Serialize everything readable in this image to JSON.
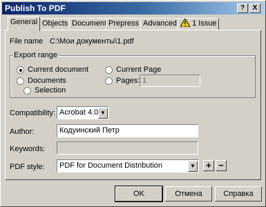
{
  "window": {
    "title": "Publish To PDF",
    "help_btn": "?",
    "close_btn": "X"
  },
  "tabs": [
    {
      "label": "General"
    },
    {
      "label": "Objects"
    },
    {
      "label": "Document"
    },
    {
      "label": "Prepress"
    },
    {
      "label": "Advanced"
    },
    {
      "label": "1 Issue",
      "icon": "warning-icon"
    }
  ],
  "general": {
    "file_name_label": "File name",
    "file_name_value": "C:\\Мои документы\\1.pdf",
    "export_range": {
      "legend": "Export range",
      "options": [
        {
          "label": "Current document",
          "selected": true
        },
        {
          "label": "Documents",
          "selected": false
        },
        {
          "label": "Selection",
          "selected": false
        },
        {
          "label": "Current Page",
          "selected": false
        },
        {
          "label": "Pages:",
          "selected": false
        }
      ],
      "pages_value": "1"
    },
    "compatibility_label": "Compatibility:",
    "compatibility_value": "Acrobat 4.0",
    "author_label": "Author:",
    "author_value": "Кодуинский Петр",
    "keywords_label": "Keywords:",
    "keywords_value": "",
    "pdf_style_label": "PDF style:",
    "pdf_style_value": "PDF for Document Distribution",
    "add_style": "+",
    "remove_style": "−"
  },
  "buttons": {
    "ok": "OK",
    "cancel": "Отмена",
    "help": "Справка"
  },
  "colors": {
    "title_start": "#0a246a",
    "title_end": "#a6caf0",
    "face": "#d4d0c8"
  }
}
